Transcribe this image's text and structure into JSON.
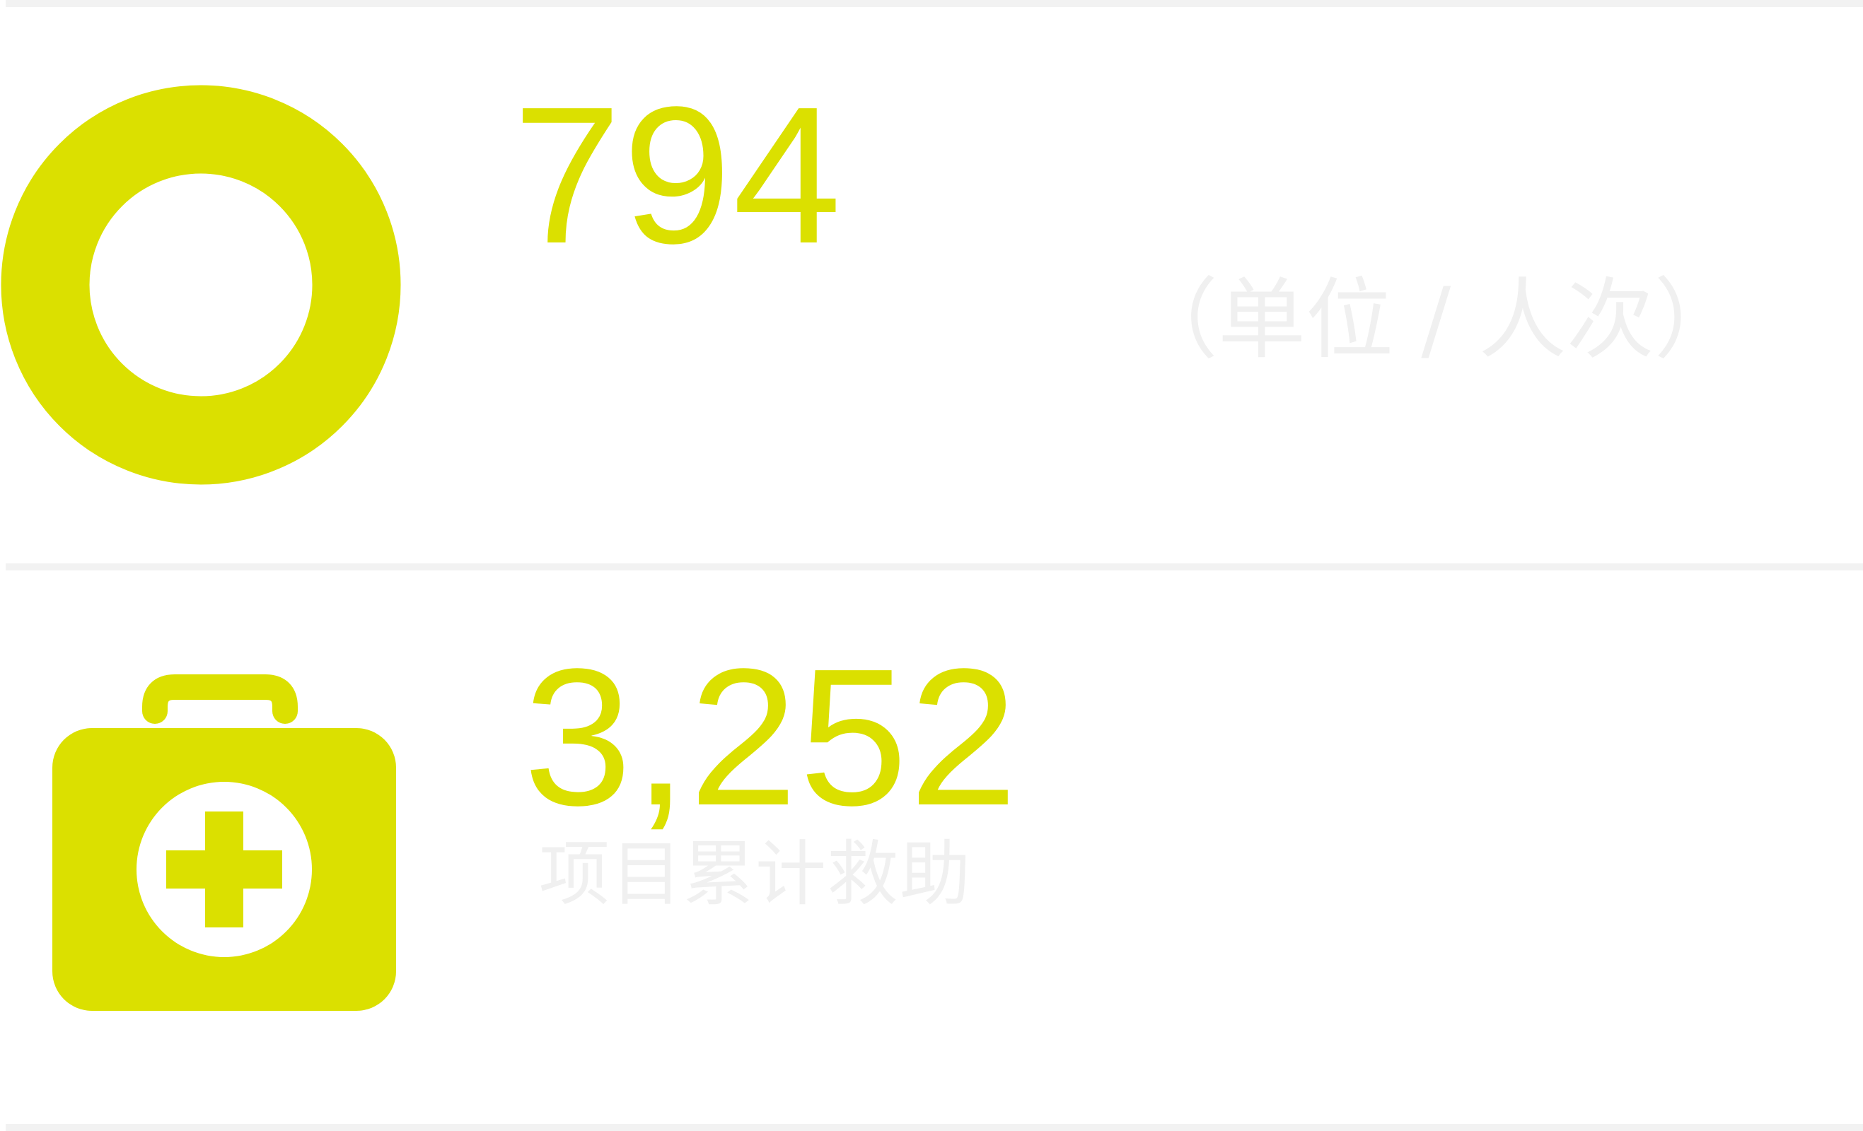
{
  "theme": {
    "accent": "#dbe000",
    "muted_text": "#f0f0f0",
    "divider": "#f2f2f2"
  },
  "stats": [
    {
      "icon": "ring-icon",
      "value": "794",
      "unit": "（单位 / 人次）"
    },
    {
      "icon": "first-aid-kit-icon",
      "value": "3,252",
      "label": "项目累计救助"
    }
  ]
}
